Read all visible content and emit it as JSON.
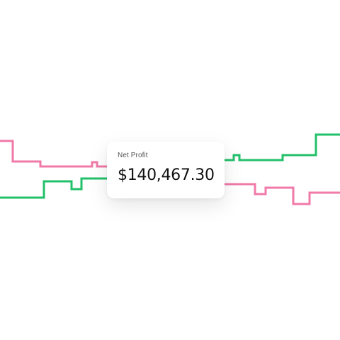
{
  "widget": {
    "label": "Net Profit",
    "value": "$140,467.30"
  },
  "colors": {
    "revenue_line": "#f07aa8",
    "profit_line": "#22c06a",
    "card_background": "#ffffff",
    "label_text": "#555555",
    "value_text": "#111111"
  }
}
